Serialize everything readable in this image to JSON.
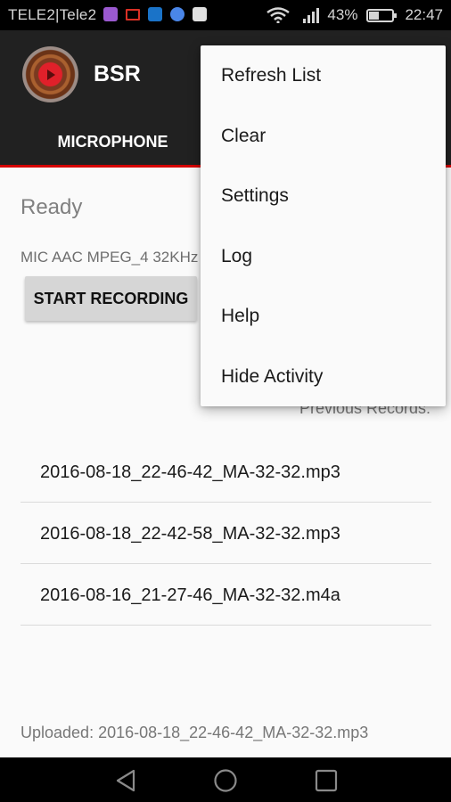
{
  "status_bar": {
    "carrier": "TELE2|Tele2",
    "notification_icons": [
      {
        "name": "gallery-icon",
        "color": "#9b59d0"
      },
      {
        "name": "gmail-icon",
        "color": "#d93025"
      },
      {
        "name": "email-icon",
        "color": "#1a73c8"
      },
      {
        "name": "files-icon",
        "color": "#4a86e8"
      },
      {
        "name": "play-store-icon",
        "color": "#e0e0e0"
      }
    ],
    "battery_percent": "43%",
    "battery_level": 0.43,
    "time": "22:47"
  },
  "app_bar": {
    "title": "BSR",
    "tabs": [
      {
        "label": "MICROPHONE"
      }
    ],
    "accent_color": "#d50000"
  },
  "main": {
    "status": "Ready",
    "config": "MIC AAC MPEG_4 32KHz",
    "start_button_label": "START RECORDING",
    "previous_records_label": "Previous Records:",
    "records": [
      "2016-08-18_22-46-42_MA-32-32.mp3",
      "2016-08-18_22-42-58_MA-32-32.mp3",
      "2016-08-16_21-27-46_MA-32-32.m4a"
    ],
    "uploaded": "Uploaded: 2016-08-18_22-46-42_MA-32-32.mp3"
  },
  "overflow_menu": {
    "items": [
      "Refresh List",
      "Clear",
      "Settings",
      "Log",
      "Help",
      "Hide Activity"
    ]
  }
}
